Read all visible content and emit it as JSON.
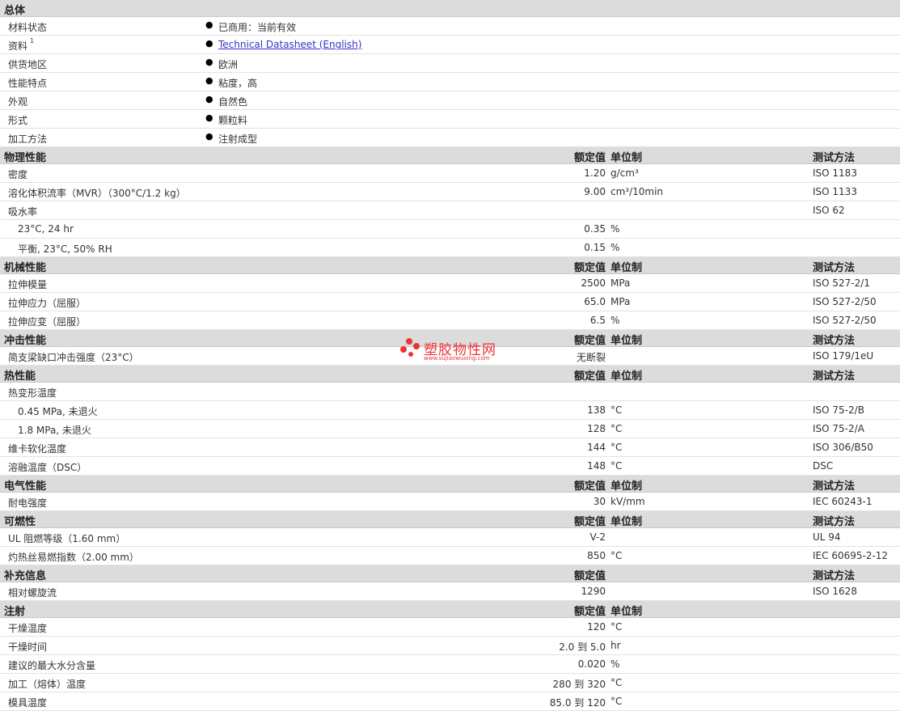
{
  "general": {
    "title": "总体",
    "rows": [
      {
        "label": "材料状态",
        "value": "已商用：当前有效",
        "link": false
      },
      {
        "label": "资料",
        "sup": "1",
        "value": "Technical Datasheet (English)",
        "link": true
      },
      {
        "label": "供货地区",
        "value": "欧洲",
        "link": false
      },
      {
        "label": "性能特点",
        "value": "粘度，高",
        "link": false
      },
      {
        "label": "外观",
        "value": "自然色",
        "link": false
      },
      {
        "label": "形式",
        "value": "颗粒料",
        "link": false
      },
      {
        "label": "加工方法",
        "value": "注射成型",
        "link": false
      }
    ]
  },
  "columns": {
    "value": "额定值",
    "unit": "单位制",
    "method": "测试方法"
  },
  "sections": [
    {
      "title": "物理性能",
      "show_unit_header": true,
      "rows": [
        {
          "label": "密度",
          "value": "1.20",
          "unit": "g/cm³",
          "method": "ISO 1183"
        },
        {
          "label": "溶化体积流率（MVR）（300°C/1.2 kg）",
          "value": "9.00",
          "unit": "cm³/10min",
          "method": "ISO 1133"
        },
        {
          "label": "吸水率",
          "value": "",
          "unit": "",
          "method": "ISO 62"
        },
        {
          "label": "23°C, 24 hr",
          "sub": true,
          "value": "0.35",
          "unit": "%",
          "method": ""
        },
        {
          "label": "平衡, 23°C, 50% RH",
          "sub": true,
          "value": "0.15",
          "unit": "%",
          "method": ""
        }
      ]
    },
    {
      "title": "机械性能",
      "show_unit_header": true,
      "rows": [
        {
          "label": "拉伸模量",
          "value": "2500",
          "unit": "MPa",
          "method": "ISO 527-2/1"
        },
        {
          "label": "拉伸应力（屈服）",
          "value": "65.0",
          "unit": "MPa",
          "method": "ISO 527-2/50"
        },
        {
          "label": "拉伸应变（屈服）",
          "value": "6.5",
          "unit": "%",
          "method": "ISO 527-2/50"
        }
      ]
    },
    {
      "title": "冲击性能",
      "show_unit_header": true,
      "rows": [
        {
          "label": "简支梁缺口冲击强度（23°C）",
          "value": "无断裂",
          "unit": "",
          "method": "ISO 179/1eU"
        }
      ]
    },
    {
      "title": "热性能",
      "show_unit_header": true,
      "rows": [
        {
          "label": "热变形温度",
          "value": "",
          "unit": "",
          "method": ""
        },
        {
          "label": "0.45 MPa, 未退火",
          "sub": true,
          "value": "138",
          "unit": "°C",
          "method": "ISO 75-2/B"
        },
        {
          "label": "1.8 MPa, 未退火",
          "sub": true,
          "value": "128",
          "unit": "°C",
          "method": "ISO 75-2/A"
        },
        {
          "label": "维卡软化温度",
          "value": "144",
          "unit": "°C",
          "method": "ISO 306/B50"
        },
        {
          "label": "溶融温度（DSC）",
          "value": "148",
          "unit": "°C",
          "method": "DSC"
        }
      ]
    },
    {
      "title": "电气性能",
      "show_unit_header": true,
      "rows": [
        {
          "label": "耐电强度",
          "value": "30",
          "unit": "kV/mm",
          "method": "IEC 60243-1"
        }
      ]
    },
    {
      "title": "可燃性",
      "show_unit_header": true,
      "rows": [
        {
          "label": "UL 阻燃等级（1.60 mm）",
          "value": "V-2",
          "unit": "",
          "method": "UL 94"
        },
        {
          "label": "灼热丝易燃指数（2.00 mm）",
          "value": "850",
          "unit": "°C",
          "method": "IEC 60695-2-12"
        }
      ]
    },
    {
      "title": "补充信息",
      "show_unit_header": false,
      "rows": [
        {
          "label": "相对螺旋流",
          "value": "1290",
          "unit": "",
          "method": "ISO 1628"
        }
      ]
    },
    {
      "title": "注射",
      "show_unit_header": true,
      "show_method_header": false,
      "rows": [
        {
          "label": "干燥温度",
          "value": "120",
          "unit": "°C",
          "method": ""
        },
        {
          "label": "干燥时间",
          "value": "2.0 到  5.0",
          "unit": "hr",
          "method": ""
        },
        {
          "label": "建议的最大水分含量",
          "value": "0.020",
          "unit": "%",
          "method": ""
        },
        {
          "label": "加工（熔体）温度",
          "value": "280 到  320",
          "unit": "°C",
          "method": ""
        },
        {
          "label": "模具温度",
          "value": "85.0 到  120",
          "unit": "°C",
          "method": ""
        }
      ]
    }
  ],
  "watermark": {
    "name": "塑胶物性网",
    "url": "www.sujiaowuxing.com",
    "color": "#ee3333"
  }
}
